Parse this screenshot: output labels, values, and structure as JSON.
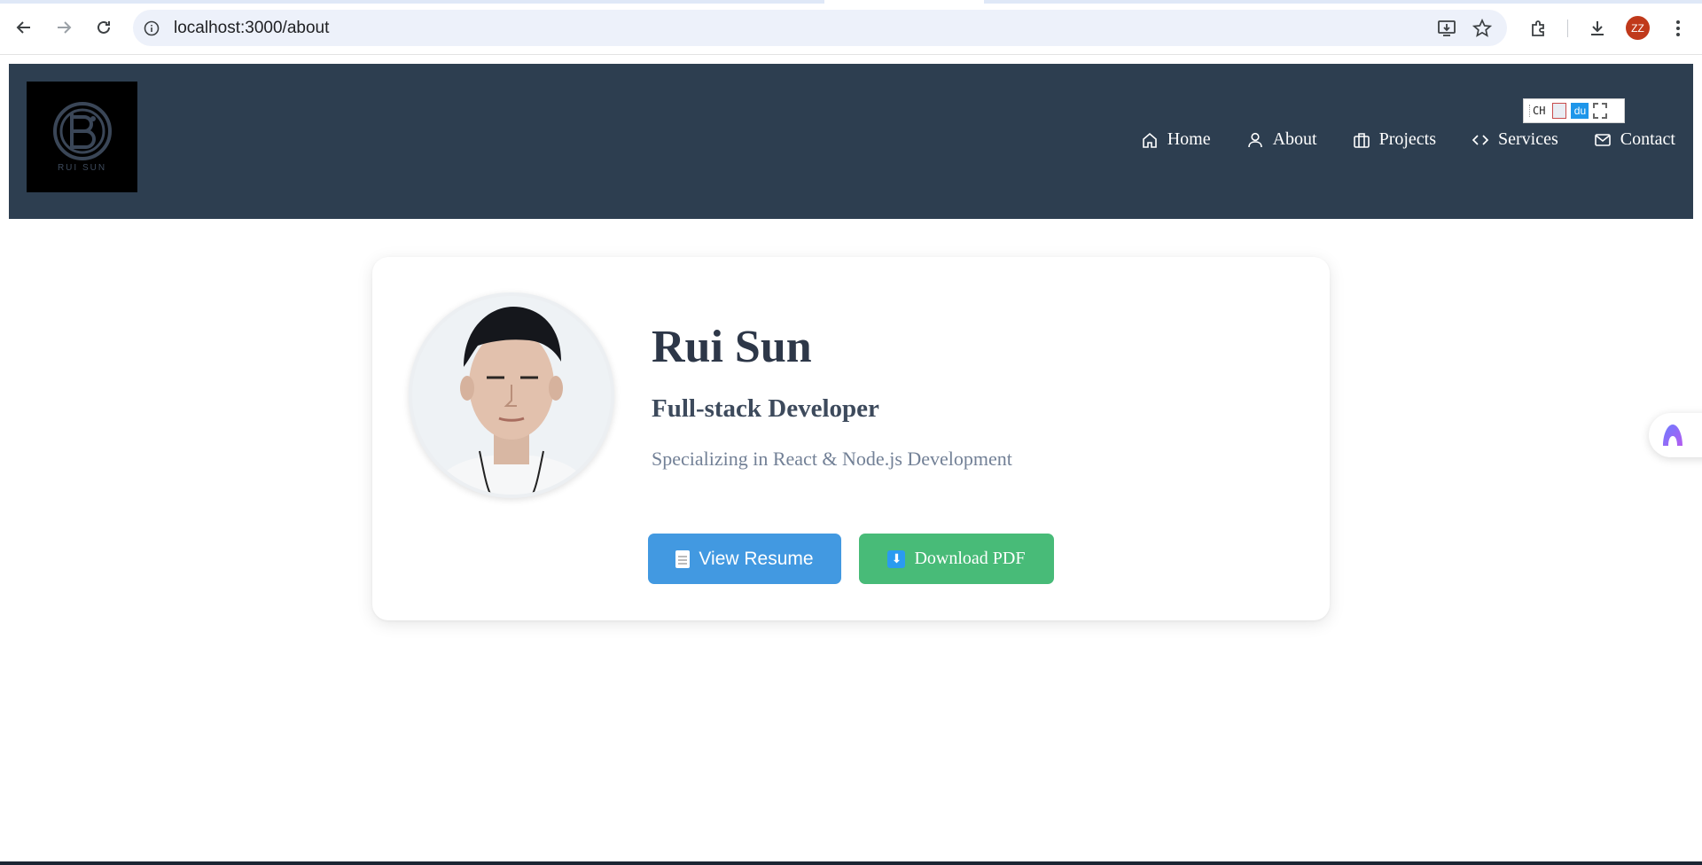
{
  "browser": {
    "url": "localhost:3000/about",
    "profile_initials": "ZZ"
  },
  "site": {
    "logo_text": "RUI SUN",
    "nav": [
      {
        "label": "Home",
        "icon": "home-icon"
      },
      {
        "label": "About",
        "icon": "user-icon"
      },
      {
        "label": "Projects",
        "icon": "briefcase-icon"
      },
      {
        "label": "Services",
        "icon": "code-icon"
      },
      {
        "label": "Contact",
        "icon": "mail-icon"
      }
    ],
    "extension_widget": {
      "ch": "CH",
      "du": "du"
    }
  },
  "profile": {
    "name": "Rui Sun",
    "title": "Full-stack Developer",
    "subtitle": "Specializing in React & Node.js Development",
    "buttons": {
      "resume": "View Resume",
      "pdf": "Download PDF"
    }
  },
  "colors": {
    "header_bg": "#2d3e50",
    "resume_button": "#4299e1",
    "pdf_button": "#48bb78",
    "avatar": "#c0391b"
  }
}
